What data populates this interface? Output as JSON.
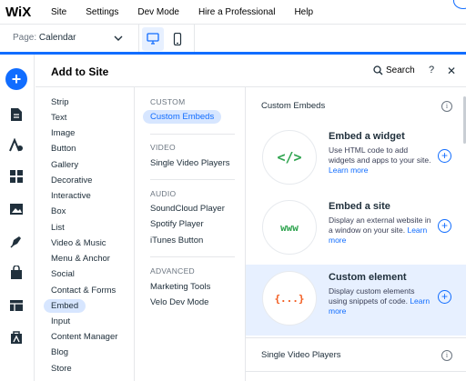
{
  "topbar": {
    "logo": "WiX",
    "menu": [
      "Site",
      "Settings",
      "Dev Mode",
      "Hire a Professional",
      "Help"
    ]
  },
  "pagebar": {
    "page_label": "Page:",
    "page_value": "Calendar"
  },
  "panel": {
    "title": "Add to Site",
    "search_label": "Search",
    "help": "?",
    "close": "✕"
  },
  "categories": [
    "Strip",
    "Text",
    "Image",
    "Button",
    "Gallery",
    "Decorative",
    "Interactive",
    "Box",
    "List",
    "Video & Music",
    "Menu & Anchor",
    "Social",
    "Contact & Forms",
    "Embed",
    "Input",
    "Content Manager",
    "Blog",
    "Store"
  ],
  "selected_category": "Embed",
  "subsections": {
    "custom": {
      "heading": "CUSTOM",
      "items": [
        "Custom Embeds"
      ]
    },
    "video": {
      "heading": "VIDEO",
      "items": [
        "Single Video Players"
      ]
    },
    "audio": {
      "heading": "AUDIO",
      "items": [
        "SoundCloud Player",
        "Spotify Player",
        "iTunes Button"
      ]
    },
    "advanced": {
      "heading": "ADVANCED",
      "items": [
        "Marketing Tools",
        "Velo Dev Mode"
      ]
    }
  },
  "content": {
    "section1_title": "Custom Embeds",
    "section2_title": "Single Video Players",
    "info": "i",
    "cards": [
      {
        "icon_text": "</>",
        "icon_color": "#2fa44f",
        "title": "Embed a widget",
        "desc": "Use HTML code to add widgets and apps to your site.",
        "learn": "Learn more"
      },
      {
        "icon_text": "www",
        "icon_color": "#2fa44f",
        "title": "Embed a site",
        "desc": "Display an external website in a window on your site.",
        "learn": "Learn more"
      },
      {
        "icon_text": "{...}",
        "icon_color": "#f25a1d",
        "title": "Custom element",
        "desc": "Display custom elements using snippets of code.",
        "learn": "Learn more"
      }
    ]
  },
  "colors": {
    "accent": "#116dff",
    "selected_bg": "#d7e6ff",
    "highlight_card_bg": "#e7f0ff"
  }
}
